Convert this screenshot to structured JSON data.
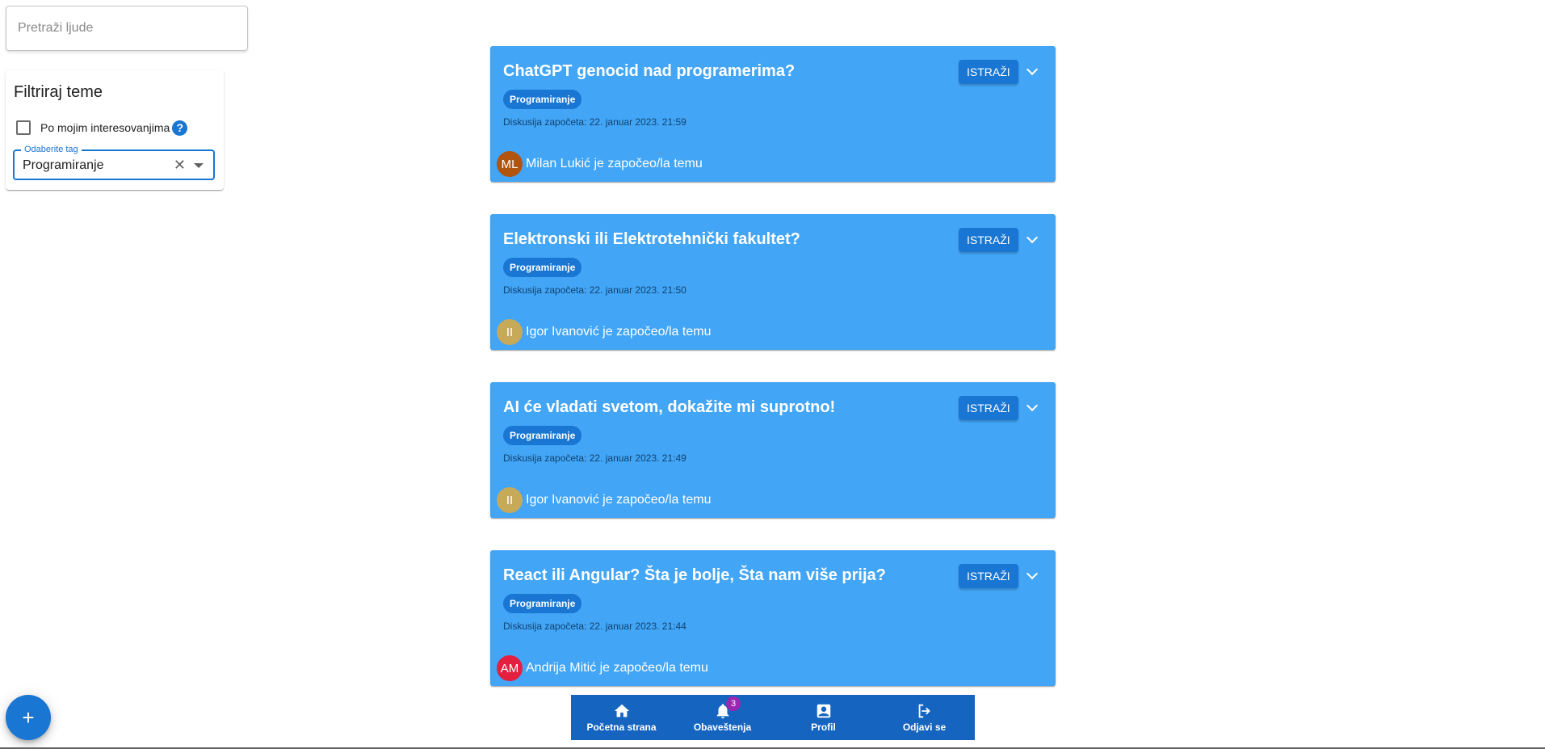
{
  "search": {
    "placeholder": "Pretraži ljude"
  },
  "filter": {
    "title": "Filtriraj teme",
    "checkbox_label": "Po mojim interesovanjima",
    "help_icon": "?",
    "tag_label": "Odaberite tag",
    "tag_value": "Programiranje",
    "clear_icon": "✕"
  },
  "topics": [
    {
      "title": "ChatGPT genocid nad programerima?",
      "tag": "Programiranje",
      "date": "Diskusija započeta: 22. januar 2023. 21:59",
      "explore": "ISTRAŽI",
      "avatar": "ML",
      "avatar_color": "#b1550e",
      "author": "Milan Lukić je započeo/la temu"
    },
    {
      "title": "Elektronski ili Elektrotehnički fakultet?",
      "tag": "Programiranje",
      "date": "Diskusija započeta: 22. januar 2023. 21:50",
      "explore": "ISTRAŽI",
      "avatar": "II",
      "avatar_color": "#c7a95a",
      "author": "Igor Ivanović je započeo/la temu"
    },
    {
      "title": "AI će vladati svetom, dokažite mi suprotno!",
      "tag": "Programiranje",
      "date": "Diskusija započeta: 22. januar 2023. 21:49",
      "explore": "ISTRAŽI",
      "avatar": "II",
      "avatar_color": "#c7a95a",
      "author": "Igor Ivanović je započeo/la temu"
    },
    {
      "title": "React ili Angular? Šta je bolje, Šta nam više prija?",
      "tag": "Programiranje",
      "date": "Diskusija započeta: 22. januar 2023. 21:44",
      "explore": "ISTRAŽI",
      "avatar": "AM",
      "avatar_color": "#e41f3f",
      "author": "Andrija Mitić je započeo/la temu"
    }
  ],
  "nav": {
    "home": "Početna strana",
    "notifications": "Obaveštenja",
    "notifications_badge": "3",
    "profile": "Profil",
    "logout": "Odjavi se"
  },
  "fab": {
    "label": "+"
  }
}
